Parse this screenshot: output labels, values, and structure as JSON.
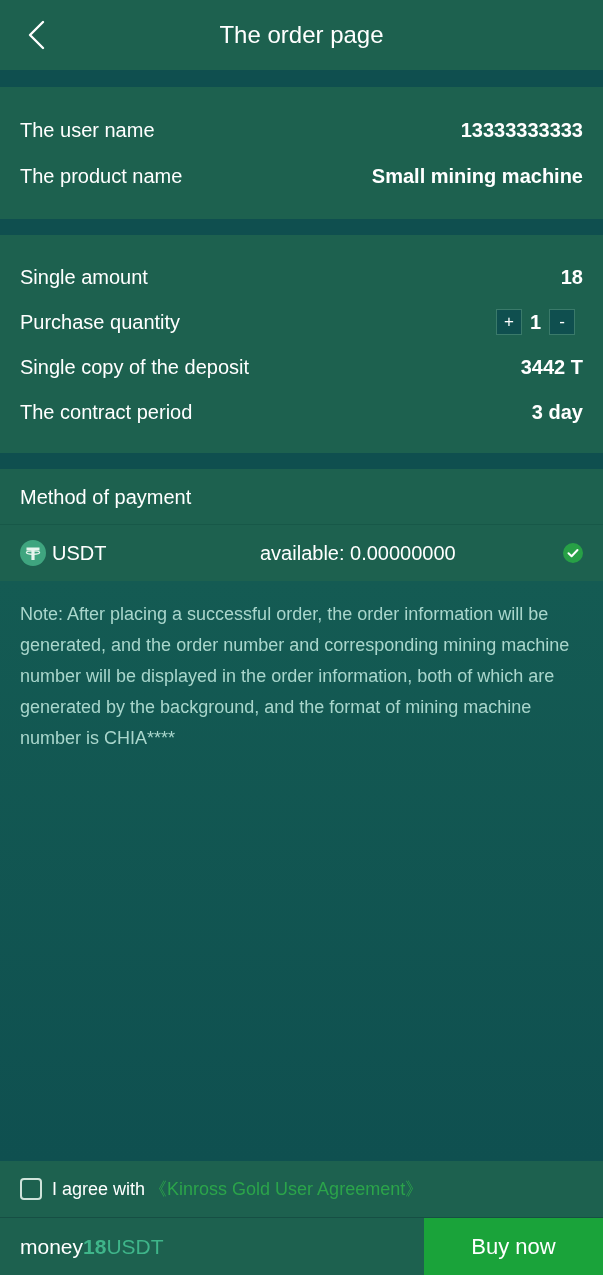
{
  "header": {
    "title": "The order page"
  },
  "product": [
    {
      "label": "The user name",
      "value": "13333333333"
    },
    {
      "label": "The product name",
      "value": "Small mining machine"
    }
  ],
  "order": [
    {
      "kind": "text",
      "label": "Single amount",
      "value": "18"
    },
    {
      "kind": "stepper",
      "label": "Purchase quantity",
      "increment": "+",
      "value": "1",
      "decrement": "-"
    },
    {
      "kind": "text",
      "label": "Single copy of the deposit",
      "value": "3442 T"
    },
    {
      "kind": "text",
      "label": "The contract period",
      "value": "3 day"
    }
  ],
  "payment": {
    "title": "Method of payment",
    "methods": [
      {
        "name": "USDT",
        "available": "available: 0.00000000",
        "selected": true
      }
    ]
  },
  "note": "Note: After placing a successful order, the order information will be generated, and the order number and corresponding mining machine number will be displayed in the order information, both of which are generated by the background, and the format of mining machine number is CHIA****",
  "agreement": {
    "checked": false,
    "text": "I agree with",
    "link": "《Kinross Gold User Agreement》"
  },
  "footer": {
    "label": "money",
    "amount": "18",
    "currency": "USDT",
    "button": "Buy now"
  }
}
